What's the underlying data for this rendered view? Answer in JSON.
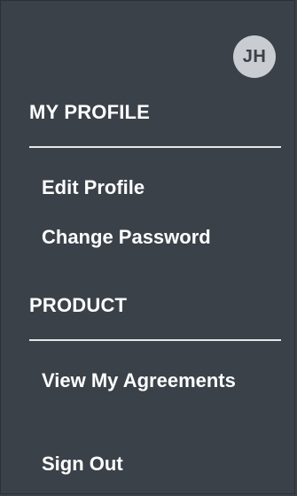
{
  "user": {
    "initials": "JH"
  },
  "sections": [
    {
      "title": "MY PROFILE",
      "items": [
        {
          "label": "Edit Profile"
        },
        {
          "label": "Change Password"
        }
      ]
    },
    {
      "title": "PRODUCT",
      "items": [
        {
          "label": "View My Agreements"
        }
      ]
    }
  ],
  "footer": {
    "sign_out_label": "Sign Out"
  },
  "colors": {
    "panel_bg": "#3a4148",
    "text": "#ffffff",
    "avatar_bg": "#c9ccd0",
    "avatar_text": "#3a4148",
    "divider": "#e5e7e9"
  }
}
